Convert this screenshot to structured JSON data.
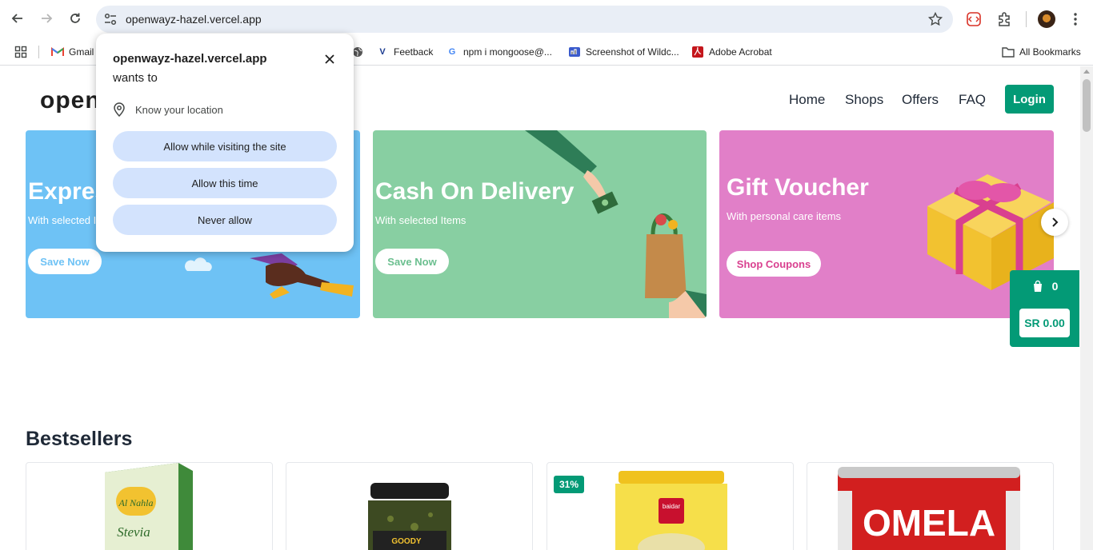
{
  "browser": {
    "url": "openwayz-hazel.vercel.app",
    "bookmarks": [
      {
        "label": "Gmail",
        "icon": "gmail-icon"
      },
      {
        "label": "",
        "icon": "globe-icon"
      },
      {
        "label": "Feetback",
        "icon": "v-icon"
      },
      {
        "label": "npm i mongoose@...",
        "icon": "google-icon"
      },
      {
        "label": "Screenshot of Wildc...",
        "icon": "screenshot-icon"
      },
      {
        "label": "Adobe Acrobat",
        "icon": "acrobat-icon"
      }
    ],
    "all_bookmarks": "All Bookmarks"
  },
  "permission_popup": {
    "site": "openwayz-hazel.vercel.app",
    "wants_to": "wants to",
    "permission": "Know your location",
    "buttons": [
      "Allow while visiting the site",
      "Allow this time",
      "Never allow"
    ]
  },
  "site": {
    "logo": "openwayz",
    "nav": [
      "Home",
      "Shops",
      "Offers",
      "FAQ"
    ],
    "login": "Login",
    "accent": "#039a76"
  },
  "banners": [
    {
      "title": "Express",
      "subtitle": "With selected Items",
      "button": "Save Now",
      "bg": "#6ec2f5"
    },
    {
      "title": "Cash On Delivery",
      "subtitle": "With selected Items",
      "button": "Save Now",
      "bg": "#88cfa2"
    },
    {
      "title": "Gift Voucher",
      "subtitle": "With personal care items",
      "button": "Shop Coupons",
      "bg": "#e17fc8"
    }
  ],
  "cart": {
    "count": "0",
    "total": "SR 0.00"
  },
  "bestsellers": {
    "title": "Bestsellers",
    "products": [
      {
        "name": "Al Nahla Stevia",
        "badge": ""
      },
      {
        "name": "Goody Pesto",
        "badge": ""
      },
      {
        "name": "Baidar",
        "badge": "31%"
      },
      {
        "name": "Omela",
        "badge": ""
      }
    ]
  }
}
